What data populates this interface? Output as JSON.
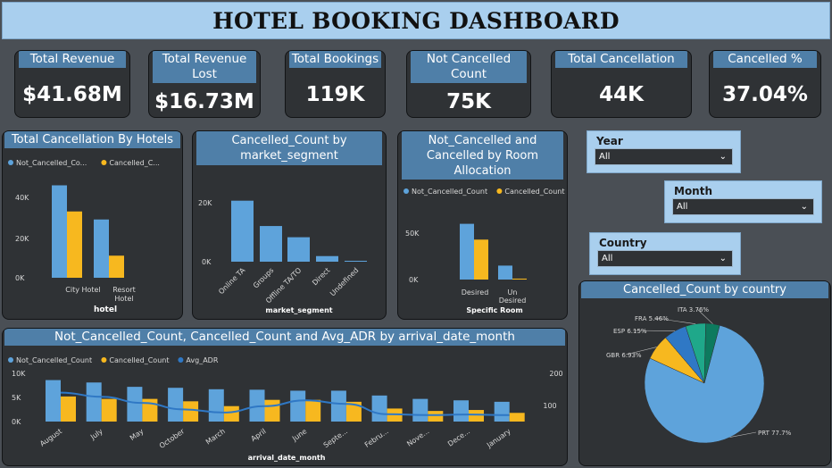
{
  "title": "HOTEL BOOKING DASHBOARD",
  "kpis": [
    {
      "label": "Total Revenue",
      "value": "$41.68M"
    },
    {
      "label": "Total Revenue Lost",
      "value": "$16.73M"
    },
    {
      "label": "Total Bookings",
      "value": "119K"
    },
    {
      "label": "Not Cancelled Count",
      "value": "75K"
    },
    {
      "label": "Total Cancellation",
      "value": "44K"
    },
    {
      "label": "Cancelled %",
      "value": "37.04%"
    }
  ],
  "slicers": {
    "year": {
      "label": "Year",
      "value": "All"
    },
    "month": {
      "label": "Month",
      "value": "All"
    },
    "country": {
      "label": "Country",
      "value": "All"
    }
  },
  "colors": {
    "not_cancelled": "#5ea3db",
    "cancelled": "#f7b81f",
    "adr": "#2f78c5",
    "panel": "#2f3235",
    "header": "#4f7fa8",
    "background": "#4a4f55"
  },
  "chart_data": [
    {
      "type": "bar",
      "title": "Total Cancellation By Hotels",
      "xlabel": "hotel",
      "categories": [
        "City Hotel",
        "Resort Hotel"
      ],
      "series": [
        {
          "name": "Not_Cancelled_Co...",
          "values": [
            46000,
            29000
          ]
        },
        {
          "name": "Cancelled_C...",
          "values": [
            33000,
            11000
          ]
        }
      ],
      "yticks": [
        "0K",
        "20K",
        "40K"
      ],
      "ylim": [
        0,
        50000
      ]
    },
    {
      "type": "bar",
      "title": "Cancelled_Count by market_segment",
      "xlabel": "market_segment",
      "categories": [
        "Online TA",
        "Groups",
        "Offline TA/TO",
        "Direct",
        "Undefined"
      ],
      "values": [
        20700,
        12100,
        8300,
        1900,
        0
      ],
      "yticks": [
        "0K",
        "20K"
      ],
      "ylim": [
        0,
        26000
      ]
    },
    {
      "type": "bar",
      "title": "Not_Cancelled and Cancelled by Room Allocation",
      "xlabel": "Specific Room",
      "categories": [
        "Desired",
        "Un Desired"
      ],
      "series": [
        {
          "name": "Not_Cancelled_Count",
          "values": [
            60000,
            15000
          ]
        },
        {
          "name": "Cancelled_Count",
          "values": [
            43000,
            1000
          ]
        }
      ],
      "yticks": [
        "0K",
        "50K"
      ],
      "ylim": [
        0,
        75000
      ]
    },
    {
      "type": "bar",
      "title": "Not_Cancelled_Count, Cancelled_Count and Avg_ADR by arrival_date_month",
      "xlabel": "arrival_date_month",
      "categories": [
        "August",
        "July",
        "May",
        "October",
        "March",
        "April",
        "June",
        "Septe...",
        "Febru...",
        "Nove...",
        "Dece...",
        "January"
      ],
      "series": [
        {
          "name": "Not_Cancelled_Count",
          "values": [
            8600,
            8100,
            7200,
            7000,
            6700,
            6600,
            6400,
            6400,
            5400,
            4700,
            4400,
            4100
          ]
        },
        {
          "name": "Cancelled_Count",
          "values": [
            5200,
            4700,
            4700,
            4200,
            3200,
            4500,
            4500,
            4100,
            2700,
            2200,
            2400,
            1800
          ]
        },
        {
          "name": "Avg_ADR",
          "values": [
            140,
            127,
            108,
            88,
            78,
            98,
            116,
            105,
            73,
            70,
            72,
            70
          ]
        }
      ],
      "yticks": [
        "0K",
        "5K",
        "10K"
      ],
      "ylim": [
        0,
        11000
      ],
      "y2ticks": [
        "100",
        "200"
      ],
      "y2lim": [
        0,
        250
      ]
    },
    {
      "type": "pie",
      "title": "Cancelled_Count by country",
      "labels": [
        "PRT",
        "GBR",
        "ESP",
        "FRA",
        "ITA"
      ],
      "values": [
        77.7,
        6.93,
        6.15,
        5.46,
        3.76
      ],
      "value_labels": [
        "PRT 77.7%",
        "GBR 6.93%",
        "ESP 6.15%",
        "FRA 5.46%",
        "ITA 3.76%"
      ],
      "colors": [
        "#5ea3db",
        "#f7b81f",
        "#2f78c5",
        "#1fa88a",
        "#0d7a5e"
      ]
    }
  ]
}
